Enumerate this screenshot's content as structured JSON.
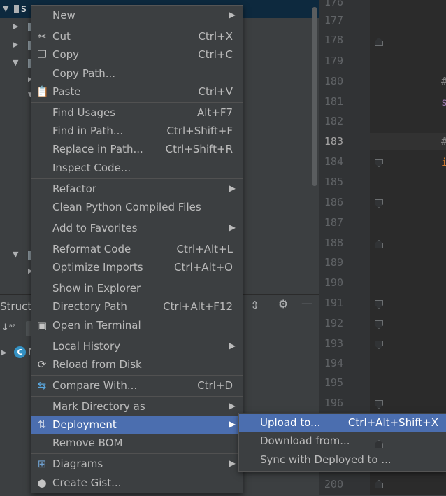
{
  "project_tree": {
    "root_label_fragment": "s"
  },
  "structure_panel": {
    "title": "Struct",
    "node_icon_letter": "C",
    "node_label_fragment": "N"
  },
  "editor": {
    "line_numbers": [
      "176",
      "177",
      "178",
      "179",
      "180",
      "181",
      "182",
      "183",
      "184",
      "185",
      "186",
      "187",
      "188",
      "189",
      "190",
      "191",
      "192",
      "193",
      "194",
      "195",
      "196",
      "",
      "",
      "200"
    ],
    "current_line": "183",
    "code_fragments": [
      {
        "text": "#",
        "color": "#808080"
      },
      {
        "text": "s",
        "color": "#9876aa"
      },
      {
        "text": "#",
        "color": "#808080"
      },
      {
        "text": "i",
        "color": "#cc7832"
      }
    ]
  },
  "context_menu": {
    "items": [
      {
        "label": "New",
        "shortcut": "",
        "submenu": true,
        "icon": ""
      },
      {
        "label": "Cut",
        "shortcut": "Ctrl+X",
        "submenu": false,
        "icon": "scissors-icon"
      },
      {
        "label": "Copy",
        "shortcut": "Ctrl+C",
        "submenu": false,
        "icon": "copy-icon"
      },
      {
        "label": "Copy Path...",
        "shortcut": "",
        "submenu": false,
        "icon": ""
      },
      {
        "label": "Paste",
        "shortcut": "Ctrl+V",
        "submenu": false,
        "icon": "clipboard-icon"
      },
      {
        "label": "Find Usages",
        "shortcut": "Alt+F7",
        "submenu": false,
        "icon": ""
      },
      {
        "label": "Find in Path...",
        "shortcut": "Ctrl+Shift+F",
        "submenu": false,
        "icon": ""
      },
      {
        "label": "Replace in Path...",
        "shortcut": "Ctrl+Shift+R",
        "submenu": false,
        "icon": ""
      },
      {
        "label": "Inspect Code...",
        "shortcut": "",
        "submenu": false,
        "icon": ""
      },
      {
        "label": "Refactor",
        "shortcut": "",
        "submenu": true,
        "icon": ""
      },
      {
        "label": "Clean Python Compiled Files",
        "shortcut": "",
        "submenu": false,
        "icon": ""
      },
      {
        "label": "Add to Favorites",
        "shortcut": "",
        "submenu": true,
        "icon": ""
      },
      {
        "label": "Reformat Code",
        "shortcut": "Ctrl+Alt+L",
        "submenu": false,
        "icon": ""
      },
      {
        "label": "Optimize Imports",
        "shortcut": "Ctrl+Alt+O",
        "submenu": false,
        "icon": ""
      },
      {
        "label": "Show in Explorer",
        "shortcut": "",
        "submenu": false,
        "icon": ""
      },
      {
        "label": "Directory Path",
        "shortcut": "Ctrl+Alt+F12",
        "submenu": false,
        "icon": ""
      },
      {
        "label": "Open in Terminal",
        "shortcut": "",
        "submenu": false,
        "icon": "terminal-icon"
      },
      {
        "label": "Local History",
        "shortcut": "",
        "submenu": true,
        "icon": ""
      },
      {
        "label": "Reload from Disk",
        "shortcut": "",
        "submenu": false,
        "icon": "reload-icon"
      },
      {
        "label": "Compare With...",
        "shortcut": "Ctrl+D",
        "submenu": false,
        "icon": "compare-icon"
      },
      {
        "label": "Mark Directory as",
        "shortcut": "",
        "submenu": true,
        "icon": ""
      },
      {
        "label": "Deployment",
        "shortcut": "",
        "submenu": true,
        "icon": "deployment-icon",
        "highlighted": true
      },
      {
        "label": "Remove BOM",
        "shortcut": "",
        "submenu": false,
        "icon": ""
      },
      {
        "label": "Diagrams",
        "shortcut": "",
        "submenu": true,
        "icon": "diagram-icon"
      },
      {
        "label": "Create Gist...",
        "shortcut": "",
        "submenu": false,
        "icon": "github-icon"
      }
    ]
  },
  "deployment_submenu": {
    "items": [
      {
        "label": "Upload to...",
        "shortcut": "Ctrl+Alt+Shift+X",
        "highlighted": true
      },
      {
        "label": "Download from...",
        "shortcut": ""
      },
      {
        "label": "Sync with Deployed to ...",
        "shortcut": ""
      }
    ]
  },
  "colors": {
    "menu_bg": "#3c3f41",
    "highlight": "#4b6eaf",
    "text": "#bbbbbb",
    "editor_bg": "#2b2b2b",
    "gutter_bg": "#313335"
  }
}
